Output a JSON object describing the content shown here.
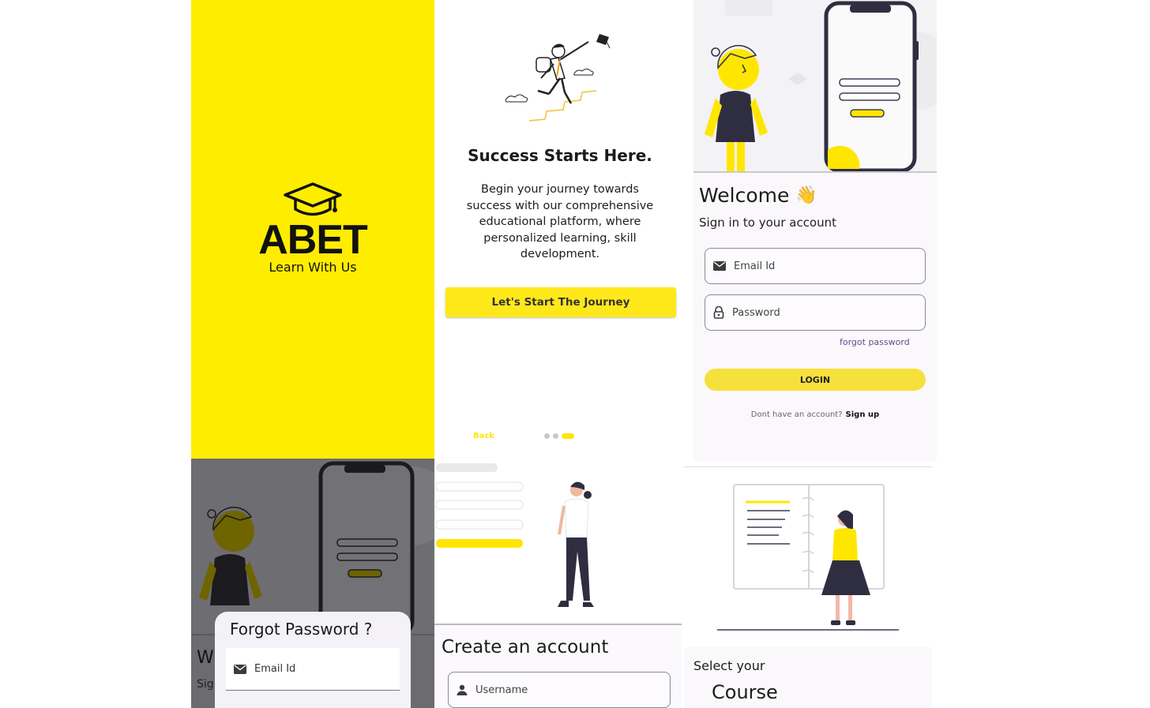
{
  "splash": {
    "brand": "ABET",
    "tagline": "Learn With Us",
    "icon": "graduation-cap-icon",
    "bg_color": "#ffed00"
  },
  "onboarding": {
    "title": "Success Starts Here.",
    "description": "Begin your journey towards success with our comprehensive educational platform, where personalized learning, skill development.",
    "cta_label": "Let's Start The Journey",
    "back_label": "Back",
    "page_count": 3,
    "active_page": 3,
    "accent_color": "#ffe600"
  },
  "login": {
    "welcome": "Welcome",
    "wave_emoji": "👋",
    "subtitle": "Sign in to your account",
    "email_placeholder": "Email Id",
    "password_placeholder": "Password",
    "forgot_label": "forgot password",
    "login_label": "LOGIN",
    "no_account_text": "Dont have an account?",
    "signup_label": "Sign up",
    "icons": [
      "mail-icon",
      "lock-icon"
    ]
  },
  "forgot": {
    "title": "Forgot Password ?",
    "email_placeholder": "Email Id",
    "bg_heading_fragment": "W",
    "bg_sub_fragment": "Sig"
  },
  "register": {
    "title": "Create an account",
    "username_placeholder": "Username",
    "icon": "person-icon"
  },
  "course": {
    "line1": "Select your",
    "line2": "Course"
  }
}
